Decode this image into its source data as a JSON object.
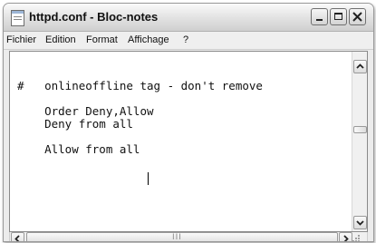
{
  "window": {
    "title": "httpd.conf - Bloc-notes",
    "icon": "notepad-icon"
  },
  "menu": {
    "items": [
      "Fichier",
      "Edition",
      "Format",
      "Affichage",
      "?"
    ]
  },
  "editor": {
    "lines": [
      "# onlineoffline tag - don't remove",
      "",
      "    Order Deny,Allow",
      "    Deny from all",
      "",
      "    Allow from all"
    ],
    "content": "#   onlineoffline tag - don't remove\n\n    Order Deny,Allow\n    Deny from all\n\n    Allow from all"
  },
  "scrollbars": {
    "horizontal_grip": "III"
  }
}
